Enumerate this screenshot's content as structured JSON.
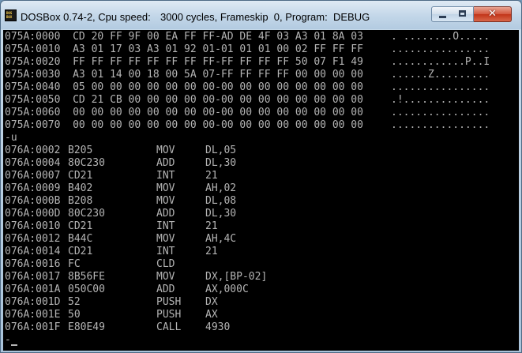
{
  "window": {
    "title_app": "DOSBox 0.74-2, Cpu speed:",
    "title_cycles": "3000 cycles, Frameskip  0, Program:",
    "title_program": "DEBUG",
    "icon_lines": [
      "DOS",
      "BOX"
    ]
  },
  "controls": {
    "minimize": "",
    "maximize": "",
    "close": "✕"
  },
  "dump": [
    {
      "addr": "075A:0000",
      "hex": "CD 20 FF 9F 00 EA FF FF-AD DE 4F 03 A3 01 8A 03",
      "ascii": ". ........O....."
    },
    {
      "addr": "075A:0010",
      "hex": "A3 01 17 03 A3 01 92 01-01 01 01 00 02 FF FF FF",
      "ascii": "................"
    },
    {
      "addr": "075A:0020",
      "hex": "FF FF FF FF FF FF FF FF-FF FF FF FF 50 07 F1 49",
      "ascii": "............P..I"
    },
    {
      "addr": "075A:0030",
      "hex": "A3 01 14 00 18 00 5A 07-FF FF FF FF 00 00 00 00",
      "ascii": "......Z........."
    },
    {
      "addr": "075A:0040",
      "hex": "05 00 00 00 00 00 00 00-00 00 00 00 00 00 00 00",
      "ascii": "................"
    },
    {
      "addr": "075A:0050",
      "hex": "CD 21 CB 00 00 00 00 00-00 00 00 00 00 00 00 00",
      "ascii": ".!.............."
    },
    {
      "addr": "075A:0060",
      "hex": "00 00 00 00 00 00 00 00-00 00 00 00 00 00 00 00",
      "ascii": "................"
    },
    {
      "addr": "075A:0070",
      "hex": "00 00 00 00 00 00 00 00-00 00 00 00 00 00 00 00",
      "ascii": "................"
    }
  ],
  "command": "-u",
  "disasm": [
    {
      "addr": "076A:0002",
      "bytes": "B205",
      "mnem": "MOV",
      "ops": "DL,05"
    },
    {
      "addr": "076A:0004",
      "bytes": "80C230",
      "mnem": "ADD",
      "ops": "DL,30"
    },
    {
      "addr": "076A:0007",
      "bytes": "CD21",
      "mnem": "INT",
      "ops": "21"
    },
    {
      "addr": "076A:0009",
      "bytes": "B402",
      "mnem": "MOV",
      "ops": "AH,02"
    },
    {
      "addr": "076A:000B",
      "bytes": "B208",
      "mnem": "MOV",
      "ops": "DL,08"
    },
    {
      "addr": "076A:000D",
      "bytes": "80C230",
      "mnem": "ADD",
      "ops": "DL,30"
    },
    {
      "addr": "076A:0010",
      "bytes": "CD21",
      "mnem": "INT",
      "ops": "21"
    },
    {
      "addr": "076A:0012",
      "bytes": "B44C",
      "mnem": "MOV",
      "ops": "AH,4C"
    },
    {
      "addr": "076A:0014",
      "bytes": "CD21",
      "mnem": "INT",
      "ops": "21"
    },
    {
      "addr": "076A:0016",
      "bytes": "FC",
      "mnem": "CLD",
      "ops": ""
    },
    {
      "addr": "076A:0017",
      "bytes": "8B56FE",
      "mnem": "MOV",
      "ops": "DX,[BP-02]"
    },
    {
      "addr": "076A:001A",
      "bytes": "050C00",
      "mnem": "ADD",
      "ops": "AX,000C"
    },
    {
      "addr": "076A:001D",
      "bytes": "52",
      "mnem": "PUSH",
      "ops": "DX"
    },
    {
      "addr": "076A:001E",
      "bytes": "50",
      "mnem": "PUSH",
      "ops": "AX"
    },
    {
      "addr": "076A:001F",
      "bytes": "E80E49",
      "mnem": "CALL",
      "ops": "4930"
    }
  ],
  "prompt": "-"
}
